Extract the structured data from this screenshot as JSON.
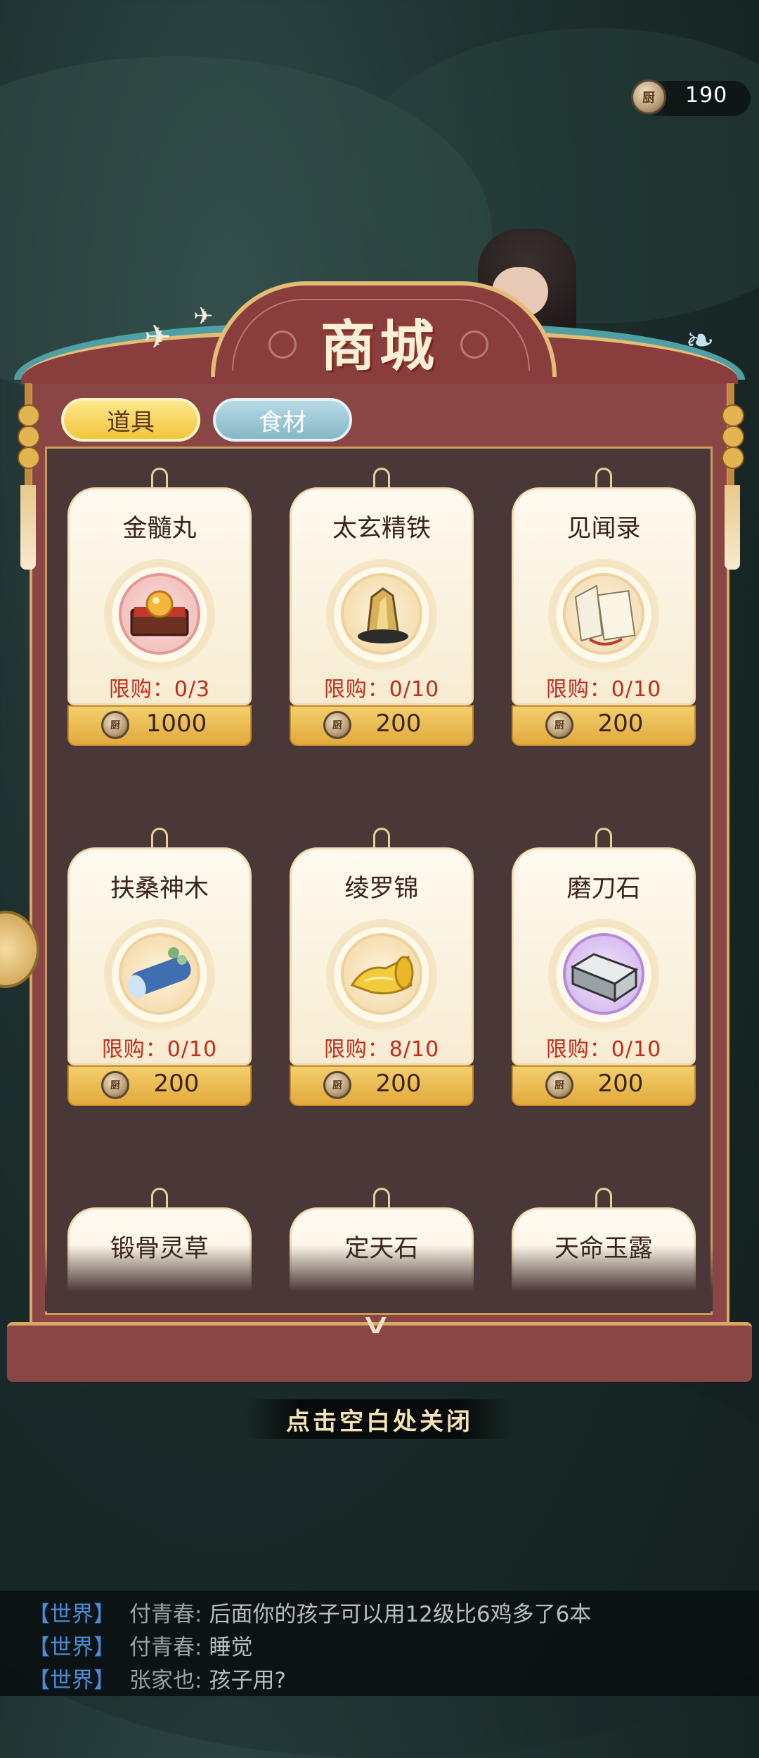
{
  "currency": {
    "icon": "chef-coin-icon",
    "coin_char": "厨",
    "amount": "190"
  },
  "shop": {
    "title": "商城",
    "tabs": [
      {
        "label": "道具",
        "active": true
      },
      {
        "label": "食材",
        "active": false
      }
    ],
    "items": [
      {
        "name": "金髓丸",
        "icon": "treasure-chest-icon",
        "limit": "限购：0/3",
        "price": "1000"
      },
      {
        "name": "太玄精铁",
        "icon": "gold-ore-icon",
        "limit": "限购：0/10",
        "price": "200"
      },
      {
        "name": "见闻录",
        "icon": "book-icon",
        "limit": "限购：0/10",
        "price": "200"
      },
      {
        "name": "扶桑神木",
        "icon": "wood-log-icon",
        "limit": "限购：0/10",
        "price": "200"
      },
      {
        "name": "绫罗锦",
        "icon": "silk-scroll-icon",
        "limit": "限购：8/10",
        "price": "200"
      },
      {
        "name": "磨刀石",
        "icon": "whetstone-icon",
        "limit": "限购：0/10",
        "price": "200"
      },
      {
        "name": "锻骨灵草",
        "icon": "herb-icon",
        "limit": "",
        "price": ""
      },
      {
        "name": "定天石",
        "icon": "stone-icon",
        "limit": "",
        "price": ""
      },
      {
        "name": "天命玉露",
        "icon": "dew-icon",
        "limit": "",
        "price": ""
      }
    ],
    "close_hint": "点击空白处关闭"
  },
  "chat": [
    {
      "channel": "【世界】",
      "name": "付青春:",
      "message": "后面你的孩子可以用12级比6鸡多了6本"
    },
    {
      "channel": "【世界】",
      "name": "付青春:",
      "message": "睡觉"
    },
    {
      "channel": "【世界】",
      "name": "张家也:",
      "message": "孩子用?"
    }
  ],
  "colors": {
    "accent_red": "#c42b18",
    "gold": "#e2a93c",
    "panel": "#8a4545"
  }
}
